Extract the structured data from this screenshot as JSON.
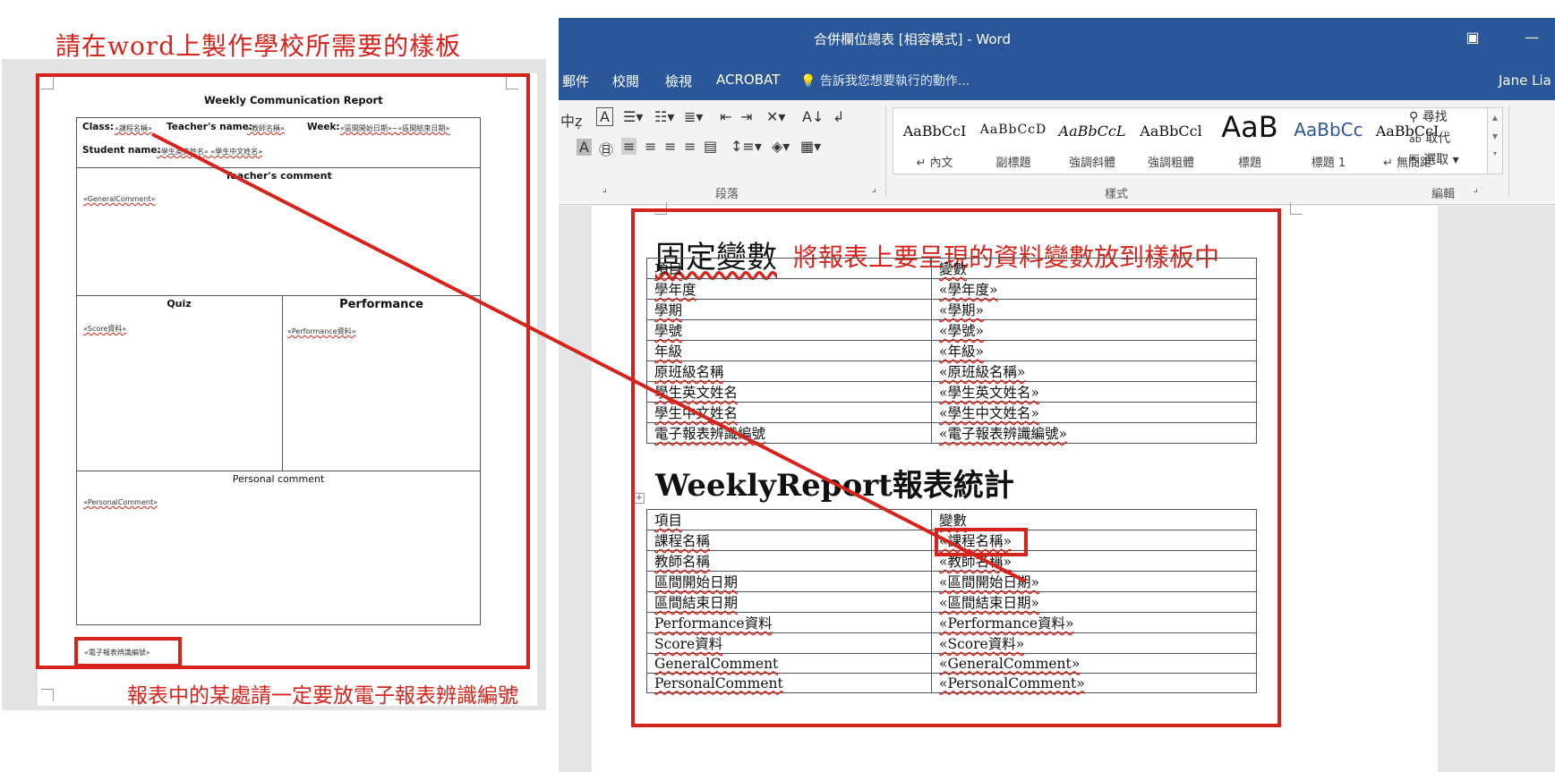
{
  "left": {
    "instruction": "請在word上製作學校所需要的樣板",
    "bottom_note": "報表中的某處請一定要放電子報表辨識編號",
    "template": {
      "title": "Weekly Communication Report",
      "class_label": "Class:",
      "class_field": "«課程名稱»",
      "teacher_label": "Teacher's name:",
      "teacher_field": "«教師名稱»",
      "week_label": "Week:",
      "week_field": "«區間開始日期»~«區間結束日期»",
      "student_label": "Student name:",
      "student_field": "«學生英文姓名»  «學生中文姓名»",
      "teacher_comment_label": "Teacher's comment",
      "general_comment_field": "«GeneralComment»",
      "quiz_label": "Quiz",
      "performance_label": "Performance",
      "score_field": "«Score資料»",
      "performance_field": "«Performance資料»",
      "personal_comment_label": "Personal comment",
      "personal_comment_field": "«PersonalComment»",
      "report_id_field": "«電子報表辨識編號»"
    }
  },
  "word": {
    "window_title": "合併欄位總表 [相容模式] - Word",
    "user_name": "Jane Lia",
    "menu": [
      "郵件",
      "校閱",
      "檢視",
      "ACROBAT"
    ],
    "tell_me": "告訴我您想要執行的動作...",
    "styles": [
      {
        "sample": "AaBbCcI",
        "name": "↵ 內文"
      },
      {
        "sample": "AaBbCcD",
        "name": "副標題"
      },
      {
        "sample": "AaBbCcL",
        "name": "強調斜體"
      },
      {
        "sample": "AaBbCcl",
        "name": "強調粗體"
      },
      {
        "sample": "AaB",
        "name": "標題"
      },
      {
        "sample": "AaBbCc",
        "name": "標題 1"
      },
      {
        "sample": "AaBbCcI",
        "name": "↵ 無間距"
      }
    ],
    "group_paragraph": "段落",
    "group_styles": "樣式",
    "group_edit": "編輯",
    "edit_find": "尋找",
    "edit_replace": "取代",
    "edit_select": "選取"
  },
  "document": {
    "heading1": "固定變數",
    "heading1_note": "將報表上要呈現的資料變數放到樣板中",
    "table1_header": [
      "項目",
      "變數"
    ],
    "table1_rows": [
      [
        "學年度",
        "«學年度»"
      ],
      [
        "學期",
        "«學期»"
      ],
      [
        "學號",
        "«學號»"
      ],
      [
        "年級",
        "«年級»"
      ],
      [
        "原班級名稱",
        "«原班級名稱»"
      ],
      [
        "學生英文姓名",
        "«學生英文姓名»"
      ],
      [
        "學生中文姓名",
        "«學生中文姓名»"
      ],
      [
        "電子報表辨識編號",
        "«電子報表辨識編號»"
      ]
    ],
    "heading2": "WeeklyReport報表統計",
    "table2_header": [
      "項目",
      "變數"
    ],
    "table2_rows": [
      [
        "課程名稱",
        "«課程名稱»"
      ],
      [
        "教師名稱",
        "«教師名稱»"
      ],
      [
        "區間開始日期",
        "«區間開始日期»"
      ],
      [
        "區間結束日期",
        "«區間結束日期»"
      ],
      [
        "Performance資料",
        "«Performance資料»"
      ],
      [
        "Score資料",
        "«Score資料»"
      ],
      [
        "GeneralComment",
        "«GeneralComment»"
      ],
      [
        "PersonalComment",
        "«PersonalComment»"
      ]
    ]
  },
  "colors": {
    "accent_red": "#d6241c",
    "word_blue": "#2b579a"
  }
}
